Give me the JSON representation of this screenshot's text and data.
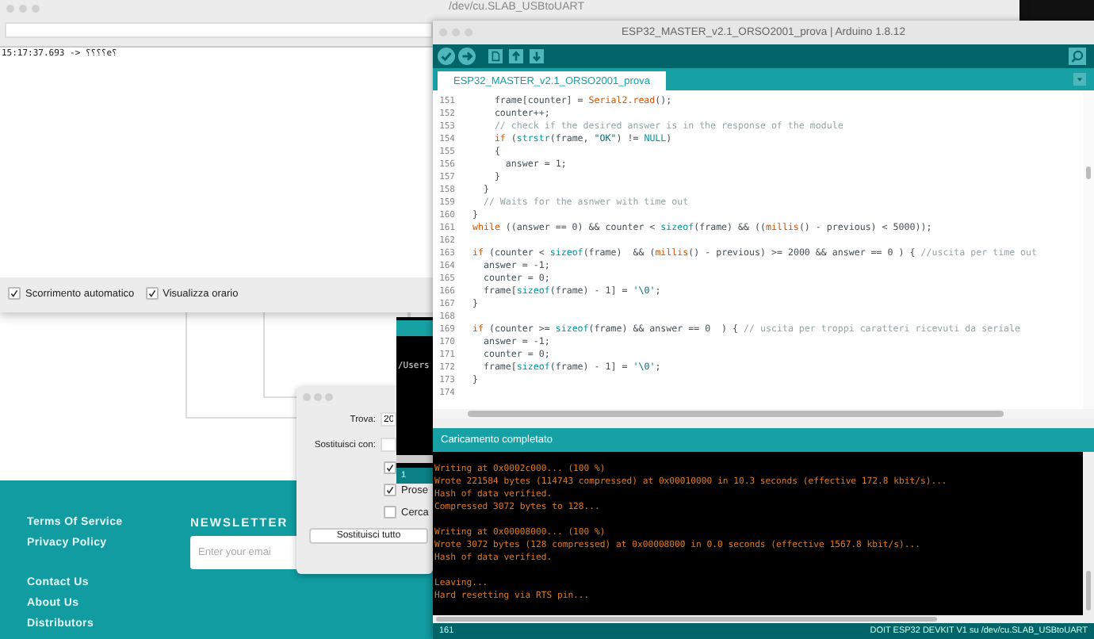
{
  "serial_monitor": {
    "title": "/dev/cu.SLAB_USBtoUART",
    "output": [
      "15:17:37.693 -> ⸮⸮⸮⸮e⸮"
    ],
    "options": [
      {
        "label": "Scorrimento automatico",
        "checked": true
      },
      {
        "label": "Visualizza orario",
        "checked": true
      }
    ]
  },
  "website_footer": {
    "link_groups": [
      [
        "Terms Of Service",
        "Privacy Policy"
      ],
      [
        "Contact Us",
        "About Us",
        "Distributors"
      ]
    ],
    "newsletter": {
      "heading": "NEWSLETTER",
      "placeholder": "Enter your emai"
    }
  },
  "find_replace_dialog": {
    "fields": [
      {
        "label": "Trova:",
        "value": "20"
      },
      {
        "label": "Sostituisci con:"
      }
    ],
    "options": [
      {
        "checked": true
      },
      {
        "label": "Prose",
        "checked": true
      },
      {
        "label": "Cerca",
        "checked": false
      }
    ],
    "button": "Sostituisci tutto"
  },
  "background_console": {
    "path": "/Users",
    "line": "1"
  },
  "ide": {
    "title": "ESP32_MASTER_v2.1_ORSO2001_prova | Arduino 1.8.12",
    "tabs": [
      {
        "label": "ESP32_MASTER_v2.1_ORSO2001_prova",
        "selected": true
      }
    ],
    "code": [
      {
        "n": "151",
        "segs": [
          {
            "t": "      frame[counter] = ",
            "kind": "plain"
          },
          {
            "t": "Serial2.read",
            "kind": "kw"
          },
          {
            "t": "();",
            "kind": "plain"
          }
        ]
      },
      {
        "n": "152",
        "segs": [
          {
            "t": "      counter++;",
            "kind": "plain"
          }
        ]
      },
      {
        "n": "153",
        "segs": [
          {
            "t": "      // check if the desired answer is in the response of the module",
            "kind": "comment"
          }
        ]
      },
      {
        "n": "154",
        "segs": [
          {
            "t": "      if",
            "kind": "kw"
          },
          {
            "t": " (",
            "kind": "plain"
          },
          {
            "t": "strstr",
            "kind": "fn"
          },
          {
            "t": "(frame, ",
            "kind": "plain"
          },
          {
            "t": "\"OK\"",
            "kind": "str"
          },
          {
            "t": ") != ",
            "kind": "plain"
          },
          {
            "t": "NULL",
            "kind": "fn"
          },
          {
            "t": ")",
            "kind": "plain"
          }
        ]
      },
      {
        "n": "155",
        "segs": [
          {
            "t": "      {",
            "kind": "plain"
          }
        ]
      },
      {
        "n": "156",
        "segs": [
          {
            "t": "        answer = 1;",
            "kind": "plain"
          }
        ]
      },
      {
        "n": "157",
        "segs": [
          {
            "t": "      }",
            "kind": "plain"
          }
        ]
      },
      {
        "n": "158",
        "segs": [
          {
            "t": "    }",
            "kind": "plain"
          }
        ]
      },
      {
        "n": "159",
        "segs": [
          {
            "t": "    // Waits for the asnwer with time out",
            "kind": "comment"
          }
        ]
      },
      {
        "n": "160",
        "segs": [
          {
            "t": "  }",
            "kind": "plain"
          }
        ]
      },
      {
        "n": "161",
        "segs": [
          {
            "t": "  while",
            "kind": "kw"
          },
          {
            "t": " ((answer == 0) && counter < ",
            "kind": "plain"
          },
          {
            "t": "sizeof",
            "kind": "fn"
          },
          {
            "t": "(frame) && ((",
            "kind": "plain"
          },
          {
            "t": "millis",
            "kind": "kw"
          },
          {
            "t": "() - previous) < 5000));",
            "kind": "plain"
          }
        ]
      },
      {
        "n": "162"
      },
      {
        "n": "163",
        "segs": [
          {
            "t": "  if",
            "kind": "kw"
          },
          {
            "t": " (counter < ",
            "kind": "plain"
          },
          {
            "t": "sizeof",
            "kind": "fn"
          },
          {
            "t": "(frame)  && (",
            "kind": "plain"
          },
          {
            "t": "millis",
            "kind": "kw"
          },
          {
            "t": "() - previous) >= 2000 && answer == 0 ) { ",
            "kind": "plain"
          },
          {
            "t": "//uscita per time out",
            "kind": "comment"
          }
        ]
      },
      {
        "n": "164",
        "segs": [
          {
            "t": "    answer = -1;",
            "kind": "plain"
          }
        ]
      },
      {
        "n": "165",
        "segs": [
          {
            "t": "    counter = 0;",
            "kind": "plain"
          }
        ]
      },
      {
        "n": "166",
        "segs": [
          {
            "t": "    frame[",
            "kind": "plain"
          },
          {
            "t": "sizeof",
            "kind": "fn"
          },
          {
            "t": "(frame) - 1] = ",
            "kind": "plain"
          },
          {
            "t": "'\\0'",
            "kind": "str"
          },
          {
            "t": ";",
            "kind": "plain"
          }
        ]
      },
      {
        "n": "167",
        "segs": [
          {
            "t": "  }",
            "kind": "plain"
          }
        ]
      },
      {
        "n": "168"
      },
      {
        "n": "169",
        "segs": [
          {
            "t": "  if",
            "kind": "kw"
          },
          {
            "t": " (counter >= ",
            "kind": "plain"
          },
          {
            "t": "sizeof",
            "kind": "fn"
          },
          {
            "t": "(frame) && answer == 0  ) { ",
            "kind": "plain"
          },
          {
            "t": "// uscita per troppi caratteri ricevuti da seriale",
            "kind": "comment"
          }
        ]
      },
      {
        "n": "170",
        "segs": [
          {
            "t": "    answer = -1;",
            "kind": "plain"
          }
        ]
      },
      {
        "n": "171",
        "segs": [
          {
            "t": "    counter = 0;",
            "kind": "plain"
          }
        ]
      },
      {
        "n": "172",
        "segs": [
          {
            "t": "    frame[",
            "kind": "plain"
          },
          {
            "t": "sizeof",
            "kind": "fn"
          },
          {
            "t": "(frame) - 1] = ",
            "kind": "plain"
          },
          {
            "t": "'\\0'",
            "kind": "str"
          },
          {
            "t": ";",
            "kind": "plain"
          }
        ]
      },
      {
        "n": "173",
        "segs": [
          {
            "t": "  }",
            "kind": "plain"
          }
        ]
      },
      {
        "n": "174"
      }
    ],
    "status_message": "Caricamento completato",
    "console_blocks": [
      [
        "Writing at 0x0002c000... (100 %)",
        "Wrote 221584 bytes (114743 compressed) at 0x00010000 in 10.3 seconds (effective 172.8 kbit/s)...",
        "Hash of data verified.",
        "Compressed 3072 bytes to 128..."
      ],
      [
        "Writing at 0x00008000... (100 %)",
        "Wrote 3072 bytes (128 compressed) at 0x00008000 in 0.0 seconds (effective 1567.8 kbit/s)...",
        "Hash of data verified."
      ],
      [
        "Leaving...",
        "Hard resetting via RTS pin..."
      ]
    ],
    "status_bar": {
      "line": "161",
      "board": "DOIT ESP32 DEVKIT V1 su /dev/cu.SLAB_USBtoUART"
    }
  }
}
